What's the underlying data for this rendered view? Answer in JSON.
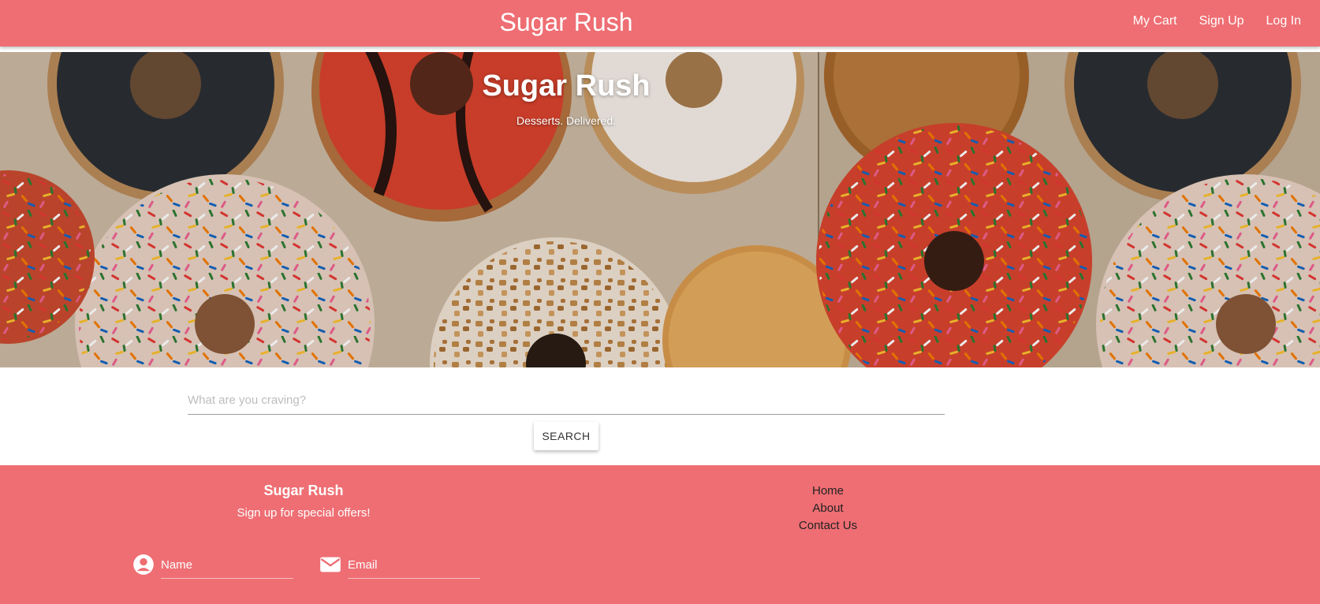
{
  "header": {
    "brand": "Sugar Rush",
    "nav": [
      "My Cart",
      "Sign Up",
      "Log In"
    ]
  },
  "hero": {
    "title": "Sugar Rush",
    "subtitle": "Desserts. Delivered.",
    "image": "donuts-photo"
  },
  "search": {
    "placeholder": "What are you craving?",
    "button_label": "SEARCH"
  },
  "footer": {
    "brand": "Sugar Rush",
    "tagline": "Sign up for special offers!",
    "links": [
      "Home",
      "About",
      "Contact Us"
    ],
    "signup": {
      "name_placeholder": "Name",
      "email_placeholder": "Email",
      "name_icon": "account-circle-icon",
      "email_icon": "email-icon"
    }
  },
  "colors": {
    "primary": "#ee6e73",
    "text_light": "#ffffff",
    "link_dark": "#222222"
  }
}
